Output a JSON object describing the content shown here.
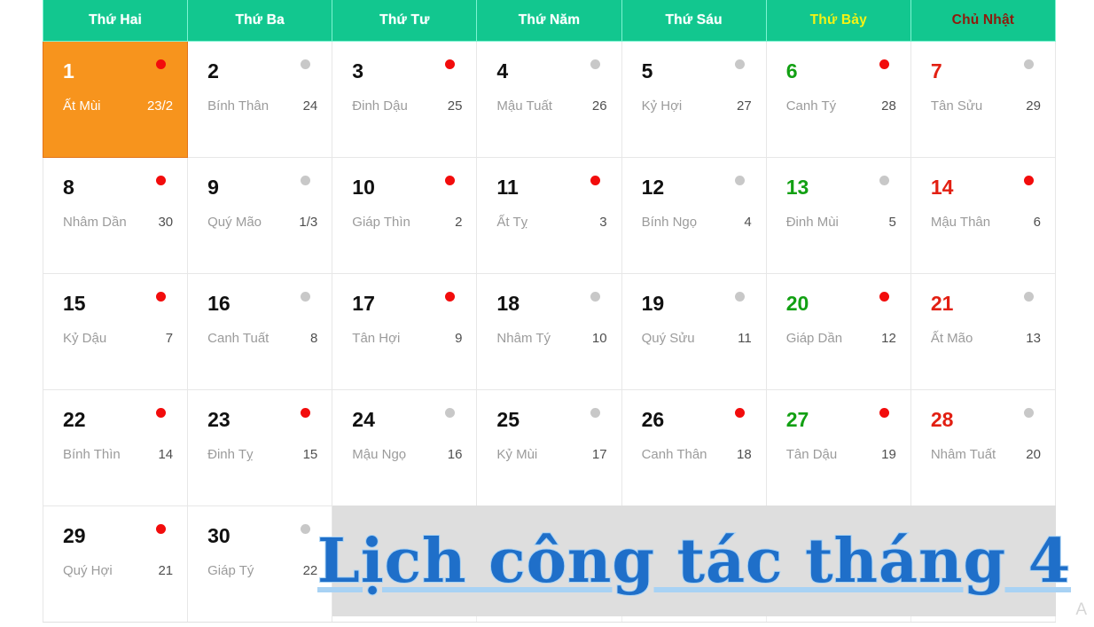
{
  "calendar": {
    "headers": [
      {
        "label": "Thứ Hai",
        "kind": "weekday"
      },
      {
        "label": "Thứ Ba",
        "kind": "weekday"
      },
      {
        "label": "Thứ Tư",
        "kind": "weekday"
      },
      {
        "label": "Thứ Năm",
        "kind": "weekday"
      },
      {
        "label": "Thứ Sáu",
        "kind": "weekday"
      },
      {
        "label": "Thứ Bảy",
        "kind": "saturday"
      },
      {
        "label": "Chủ Nhật",
        "kind": "sunday"
      }
    ],
    "header_colors": {
      "background": "#12c78f",
      "weekday_text": "#ffffff",
      "saturday_text": "#f5f314",
      "sunday_text": "#8f1a0c"
    },
    "today_highlight_color": "#f7941d",
    "dot_colors": {
      "active": "#f20c0c",
      "inactive": "#c8c8c8"
    },
    "weeks": [
      [
        {
          "day": "1",
          "lunar_name": "Ất Mùi",
          "lunar_day": "23/2",
          "dot": "red",
          "kind": "today"
        },
        {
          "day": "2",
          "lunar_name": "Bính Thân",
          "lunar_day": "24",
          "dot": "gray",
          "kind": "weekday"
        },
        {
          "day": "3",
          "lunar_name": "Đinh Dậu",
          "lunar_day": "25",
          "dot": "red",
          "kind": "weekday"
        },
        {
          "day": "4",
          "lunar_name": "Mậu Tuất",
          "lunar_day": "26",
          "dot": "gray",
          "kind": "weekday"
        },
        {
          "day": "5",
          "lunar_name": "Kỷ Hợi",
          "lunar_day": "27",
          "dot": "gray",
          "kind": "weekday"
        },
        {
          "day": "6",
          "lunar_name": "Canh Tý",
          "lunar_day": "28",
          "dot": "red",
          "kind": "saturday"
        },
        {
          "day": "7",
          "lunar_name": "Tân Sửu",
          "lunar_day": "29",
          "dot": "gray",
          "kind": "sunday"
        }
      ],
      [
        {
          "day": "8",
          "lunar_name": "Nhâm Dần",
          "lunar_day": "30",
          "dot": "red",
          "kind": "weekday"
        },
        {
          "day": "9",
          "lunar_name": "Quý Mão",
          "lunar_day": "1/3",
          "dot": "gray",
          "kind": "weekday"
        },
        {
          "day": "10",
          "lunar_name": "Giáp Thìn",
          "lunar_day": "2",
          "dot": "red",
          "kind": "weekday"
        },
        {
          "day": "11",
          "lunar_name": "Ất Tỵ",
          "lunar_day": "3",
          "dot": "red",
          "kind": "weekday"
        },
        {
          "day": "12",
          "lunar_name": "Bính Ngọ",
          "lunar_day": "4",
          "dot": "gray",
          "kind": "weekday"
        },
        {
          "day": "13",
          "lunar_name": "Đinh Mùi",
          "lunar_day": "5",
          "dot": "gray",
          "kind": "saturday"
        },
        {
          "day": "14",
          "lunar_name": "Mậu Thân",
          "lunar_day": "6",
          "dot": "red",
          "kind": "sunday"
        }
      ],
      [
        {
          "day": "15",
          "lunar_name": "Kỷ Dậu",
          "lunar_day": "7",
          "dot": "red",
          "kind": "weekday"
        },
        {
          "day": "16",
          "lunar_name": "Canh Tuất",
          "lunar_day": "8",
          "dot": "gray",
          "kind": "weekday"
        },
        {
          "day": "17",
          "lunar_name": "Tân Hợi",
          "lunar_day": "9",
          "dot": "red",
          "kind": "weekday"
        },
        {
          "day": "18",
          "lunar_name": "Nhâm Tý",
          "lunar_day": "10",
          "dot": "gray",
          "kind": "weekday"
        },
        {
          "day": "19",
          "lunar_name": "Quý Sửu",
          "lunar_day": "11",
          "dot": "gray",
          "kind": "weekday"
        },
        {
          "day": "20",
          "lunar_name": "Giáp Dần",
          "lunar_day": "12",
          "dot": "red",
          "kind": "saturday"
        },
        {
          "day": "21",
          "lunar_name": "Ất Mão",
          "lunar_day": "13",
          "dot": "gray",
          "kind": "sunday"
        }
      ],
      [
        {
          "day": "22",
          "lunar_name": "Bính Thìn",
          "lunar_day": "14",
          "dot": "red",
          "kind": "weekday"
        },
        {
          "day": "23",
          "lunar_name": "Đinh Tỵ",
          "lunar_day": "15",
          "dot": "red",
          "kind": "weekday"
        },
        {
          "day": "24",
          "lunar_name": "Mậu Ngọ",
          "lunar_day": "16",
          "dot": "gray",
          "kind": "weekday"
        },
        {
          "day": "25",
          "lunar_name": "Kỷ Mùi",
          "lunar_day": "17",
          "dot": "gray",
          "kind": "weekday"
        },
        {
          "day": "26",
          "lunar_name": "Canh Thân",
          "lunar_day": "18",
          "dot": "red",
          "kind": "weekday"
        },
        {
          "day": "27",
          "lunar_name": "Tân Dậu",
          "lunar_day": "19",
          "dot": "red",
          "kind": "saturday"
        },
        {
          "day": "28",
          "lunar_name": "Nhâm Tuất",
          "lunar_day": "20",
          "dot": "gray",
          "kind": "sunday"
        }
      ],
      [
        {
          "day": "29",
          "lunar_name": "Quý Hợi",
          "lunar_day": "21",
          "dot": "red",
          "kind": "weekday"
        },
        {
          "day": "30",
          "lunar_name": "Giáp Tý",
          "lunar_day": "22",
          "dot": "gray",
          "kind": "weekday"
        },
        {
          "day": "",
          "lunar_name": "",
          "lunar_day": "",
          "dot": "none",
          "kind": "empty"
        },
        {
          "day": "",
          "lunar_name": "",
          "lunar_day": "",
          "dot": "none",
          "kind": "empty"
        },
        {
          "day": "",
          "lunar_name": "",
          "lunar_day": "",
          "dot": "none",
          "kind": "empty"
        },
        {
          "day": "",
          "lunar_name": "",
          "lunar_day": "",
          "dot": "none",
          "kind": "empty"
        },
        {
          "day": "",
          "lunar_name": "",
          "lunar_day": "",
          "dot": "none",
          "kind": "empty"
        }
      ]
    ]
  },
  "banner": {
    "title": "Lịch công tác tháng 4",
    "background_color": "#dedede",
    "text_color": "#1f6fc9",
    "outline_color": "#a8d2f4",
    "shadow_color": "#9b1010"
  },
  "corner": {
    "mark": "A"
  }
}
